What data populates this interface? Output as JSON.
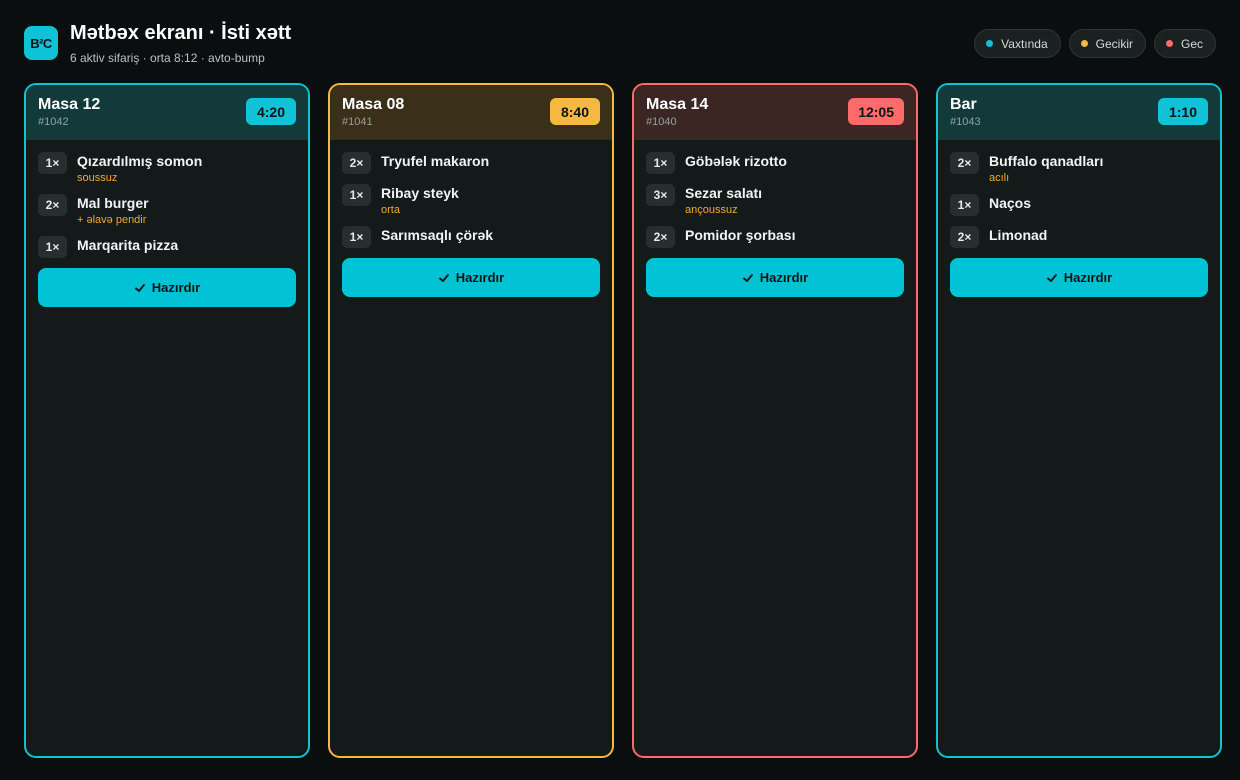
{
  "header": {
    "logo": "B²C",
    "title": "Mətbəx ekranı · İsti xətt",
    "subtitle": "6 aktiv sifariş · orta 8:12 · avto-bump"
  },
  "legend": [
    {
      "label": "Vaxtında",
      "color": "#10c2d6"
    },
    {
      "label": "Gecikir",
      "color": "#f5b942"
    },
    {
      "label": "Gec",
      "color": "#ff6b6b"
    }
  ],
  "ready_label": "Hazırdır",
  "tickets": [
    {
      "name": "Masa 12",
      "id": "#1042",
      "timer": "4:20",
      "status": "on-time",
      "accent": "#10c2d6",
      "head_bg": "#123a3a",
      "items": [
        {
          "qty": "1×",
          "name": "Qızardılmış somon",
          "note": "soussuz"
        },
        {
          "qty": "2×",
          "name": "Mal burger",
          "note": "+ əlavə pendir"
        },
        {
          "qty": "1×",
          "name": "Marqarita pizza",
          "note": ""
        }
      ]
    },
    {
      "name": "Masa 08",
      "id": "#1041",
      "timer": "8:40",
      "status": "delayed",
      "accent": "#f5b942",
      "head_bg": "#3a2f18",
      "items": [
        {
          "qty": "2×",
          "name": "Tryufel makaron",
          "note": ""
        },
        {
          "qty": "1×",
          "name": "Ribay steyk",
          "note": "orta"
        },
        {
          "qty": "1×",
          "name": "Sarımsaqlı çörək",
          "note": ""
        }
      ]
    },
    {
      "name": "Masa 14",
      "id": "#1040",
      "timer": "12:05",
      "status": "late",
      "accent": "#ff6b6b",
      "head_bg": "#3b2624",
      "items": [
        {
          "qty": "1×",
          "name": "Göbələk rizotto",
          "note": ""
        },
        {
          "qty": "3×",
          "name": "Sezar salatı",
          "note": "ançoussuz"
        },
        {
          "qty": "2×",
          "name": "Pomidor şorbası",
          "note": ""
        }
      ]
    },
    {
      "name": "Bar",
      "id": "#1043",
      "timer": "1:10",
      "status": "on-time",
      "accent": "#10c2d6",
      "head_bg": "#123a3a",
      "items": [
        {
          "qty": "2×",
          "name": "Buffalo qanadları",
          "note": "acılı"
        },
        {
          "qty": "1×",
          "name": "Naços",
          "note": ""
        },
        {
          "qty": "2×",
          "name": "Limonad",
          "note": ""
        }
      ]
    }
  ]
}
